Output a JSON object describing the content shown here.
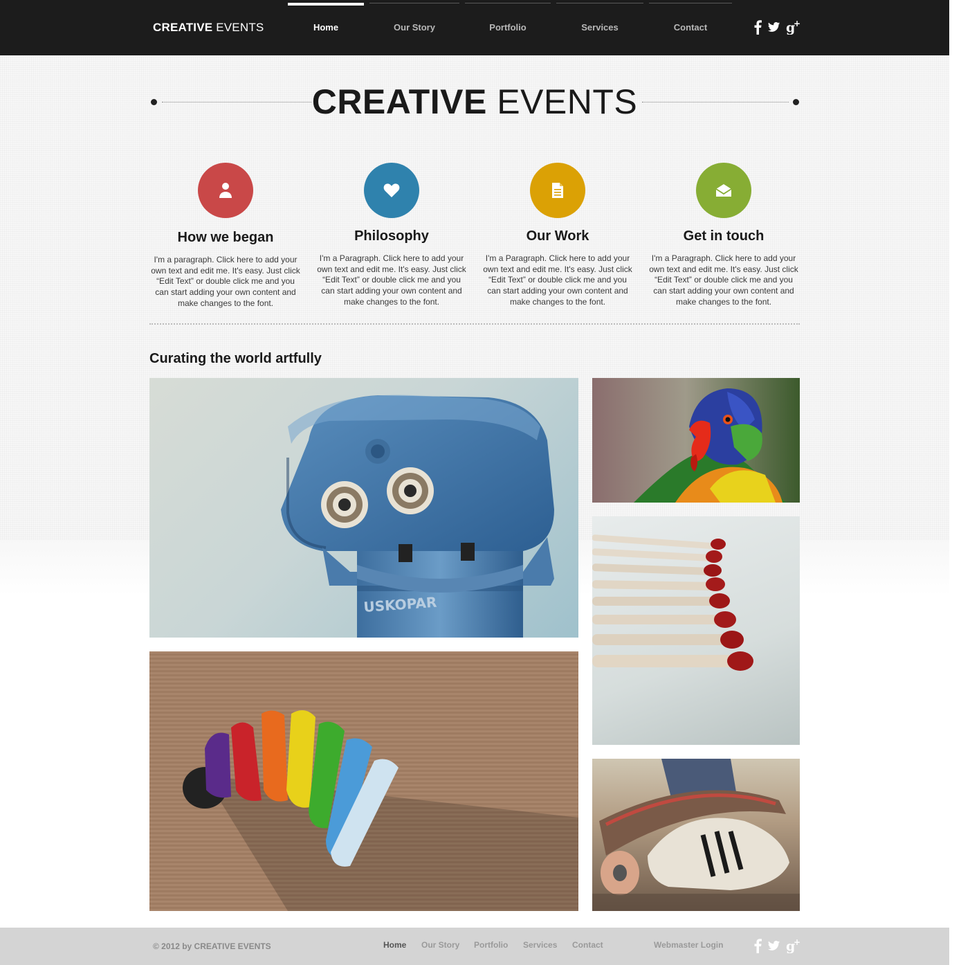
{
  "header": {
    "logo_bold": "CREATIVE",
    "logo_rest": " EVENTS",
    "nav": [
      {
        "label": "Home",
        "active": true
      },
      {
        "label": "Our Story",
        "active": false
      },
      {
        "label": "Portfolio",
        "active": false
      },
      {
        "label": "Services",
        "active": false
      },
      {
        "label": "Contact",
        "active": false
      }
    ],
    "social": [
      "facebook-icon",
      "twitter-icon",
      "google-plus-icon"
    ]
  },
  "hero": {
    "title_bold": "CREATIVE",
    "title_rest": " EVENTS"
  },
  "features": [
    {
      "icon": "person-icon",
      "color": "#c94848",
      "title": "How we began",
      "text": "I'm a paragraph. Click here to add your own text and edit me. It's easy. Just click “Edit Text” or double click me and you can start adding your own content and make changes to the font."
    },
    {
      "icon": "heart-icon",
      "color": "#2f82ad",
      "title": "Philosophy",
      "text": "I'm a Paragraph. Click here to add your own text and edit me. It's easy. Just click “Edit Text” or double click me and you can start adding your own content and make changes to the font."
    },
    {
      "icon": "document-icon",
      "color": "#dba105",
      "title": "Our Work",
      "text": "I'm a Paragraph. Click here to add your own text and edit me. It's easy. Just click “Edit Text” or double click me and you can start adding your own content and make changes to the font."
    },
    {
      "icon": "envelope-icon",
      "color": "#87ad34",
      "title": "Get in touch",
      "text": "I'm a Paragraph. Click here to add your own text and edit me. It's easy. Just click “Edit Text” or double click me and you can start adding your own content and make changes to the font."
    }
  ],
  "gallery": {
    "heading": "Curating the world artfully",
    "photos": [
      {
        "name": "photo-binocular-viewer",
        "subject": "blue coin-operated binocular viewer"
      },
      {
        "name": "photo-parrot",
        "subject": "rainbow lorikeet parrot"
      },
      {
        "name": "photo-matches",
        "subject": "row of red-tipped matches"
      },
      {
        "name": "photo-clay",
        "subject": "rainbow modeling clay"
      },
      {
        "name": "photo-skateboard",
        "subject": "sneaker on skateboard"
      }
    ]
  },
  "footer": {
    "copyright": "© 2012 by CREATIVE EVENTS",
    "nav": [
      {
        "label": "Home",
        "active": true
      },
      {
        "label": "Our Story",
        "active": false
      },
      {
        "label": "Portfolio",
        "active": false
      },
      {
        "label": "Services",
        "active": false
      },
      {
        "label": "Contact",
        "active": false
      }
    ],
    "login": "Webmaster Login",
    "social": [
      "facebook-icon",
      "twitter-icon",
      "google-plus-icon"
    ]
  },
  "colors": {
    "header_bg": "#1c1c1c",
    "footer_bg": "#d4d4d4",
    "red": "#c94848",
    "blue": "#2f82ad",
    "yellow": "#dba105",
    "green": "#87ad34"
  }
}
